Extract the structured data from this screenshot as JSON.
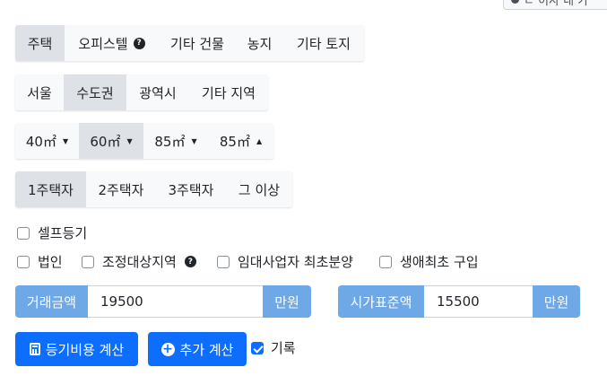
{
  "corner_button": {
    "label": "ㄷ 이사 내 가"
  },
  "property_types": [
    {
      "label": "주택",
      "active": true
    },
    {
      "label": "오피스텔",
      "help": true
    },
    {
      "label": "기타 건물"
    },
    {
      "label": "농지"
    },
    {
      "label": "기타 토지"
    }
  ],
  "regions": [
    {
      "label": "서울"
    },
    {
      "label": "수도권",
      "active": true
    },
    {
      "label": "광역시"
    },
    {
      "label": "기타 지역"
    }
  ],
  "areas": [
    {
      "label": "40㎡",
      "caret": "▼"
    },
    {
      "label": "60㎡",
      "caret": "▼",
      "active": true
    },
    {
      "label": "85㎡",
      "caret": "▼"
    },
    {
      "label": "85㎡",
      "caret": "▲"
    }
  ],
  "house_counts": [
    {
      "label": "1주택자",
      "active": true
    },
    {
      "label": "2주택자"
    },
    {
      "label": "3주택자"
    },
    {
      "label": "그 이상"
    }
  ],
  "checkboxes": {
    "self_registration": "셀프등기",
    "corporation": "법인",
    "adjusted_area": "조정대상지역",
    "rental_business": "임대사업자 최초분양",
    "first_purchase": "생애최초 구입"
  },
  "inputs": {
    "trade_amount_label": "거래금액",
    "trade_amount_value": "19500",
    "trade_amount_unit": "만원",
    "standard_price_label": "시가표준액",
    "standard_price_value": "15500",
    "standard_price_unit": "만원"
  },
  "actions": {
    "calculate_label": "등기비용 계산",
    "add_calculation_label": "추가 계산",
    "record_label": "기록"
  },
  "colors": {
    "primary": "#0d6efd",
    "input_addon": "#6ea8e6",
    "active_segment": "#dee2e6",
    "segment": "#f8f9fa"
  }
}
